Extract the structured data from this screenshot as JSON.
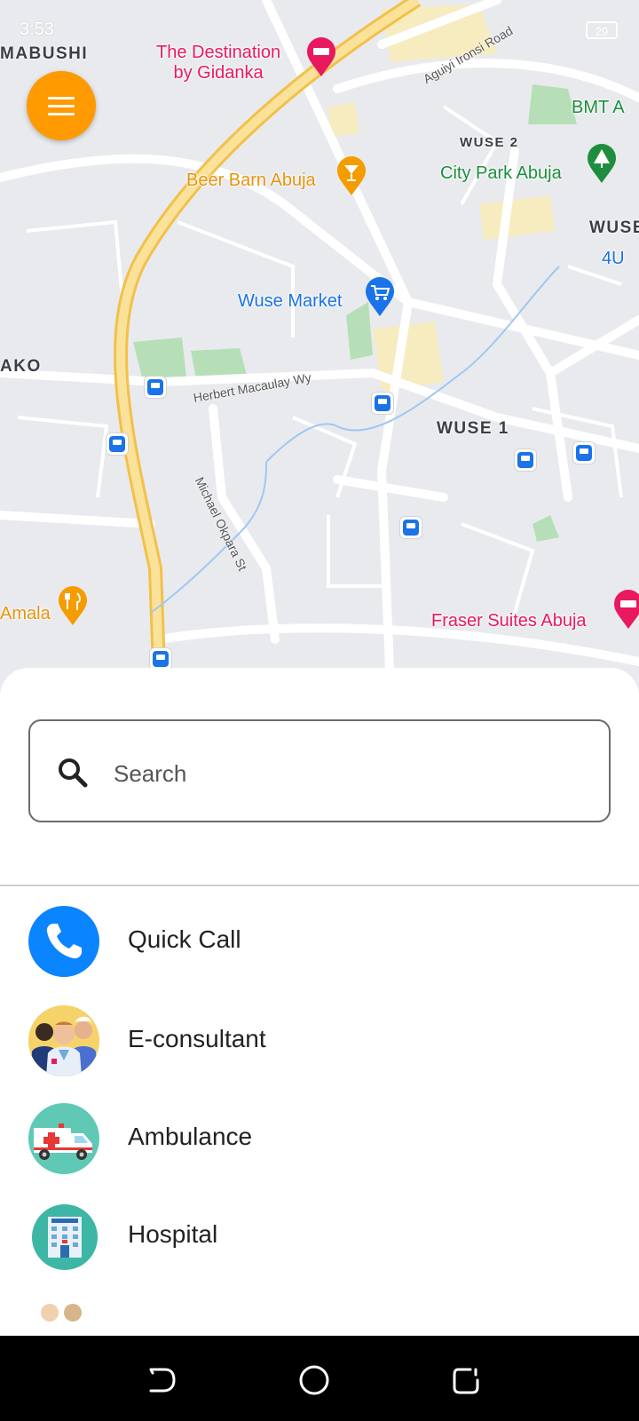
{
  "status_bar": {
    "time": "3:53",
    "battery": "29"
  },
  "map": {
    "pois": [
      {
        "name": "The Destination",
        "sub": "by Gidanka",
        "color": "#e8195f"
      },
      {
        "name": "Beer Barn Abuja",
        "color": "#e8930c"
      },
      {
        "name": "City Park Abuja",
        "color": "#1e8e3e"
      },
      {
        "name": "Wuse Market",
        "color": "#1a73e8"
      },
      {
        "name": "Fraser Suites Abuja",
        "color": "#e8195f"
      },
      {
        "name": "Amala",
        "color": "#e8930c"
      },
      {
        "name": "BMT A",
        "color": "#1e8e3e"
      },
      {
        "name": "4U",
        "color": "#1a73e8"
      }
    ],
    "areas": [
      "MABUSHI",
      "WUSE 2",
      "WUSE 1",
      "AKO",
      "WUSE"
    ],
    "streets": [
      "Herbert Macaulay Wy",
      "Michael Okpara St",
      "Aguiyi Ironsi Road"
    ]
  },
  "menu_button": {
    "icon": "hamburger-menu-icon"
  },
  "search": {
    "placeholder": "Search",
    "value": ""
  },
  "services": [
    {
      "label": "Quick Call",
      "icon": "phone-icon"
    },
    {
      "label": "E-consultant",
      "icon": "doctors-icon"
    },
    {
      "label": "Ambulance",
      "icon": "ambulance-icon"
    },
    {
      "label": "Hospital",
      "icon": "hospital-icon"
    }
  ],
  "nav": {
    "back": "back-icon",
    "home": "home-icon",
    "recents": "recents-icon"
  },
  "colors": {
    "accent": "#ff9a00",
    "call_blue": "#0a84ff",
    "teal": "#5fc9b6"
  }
}
